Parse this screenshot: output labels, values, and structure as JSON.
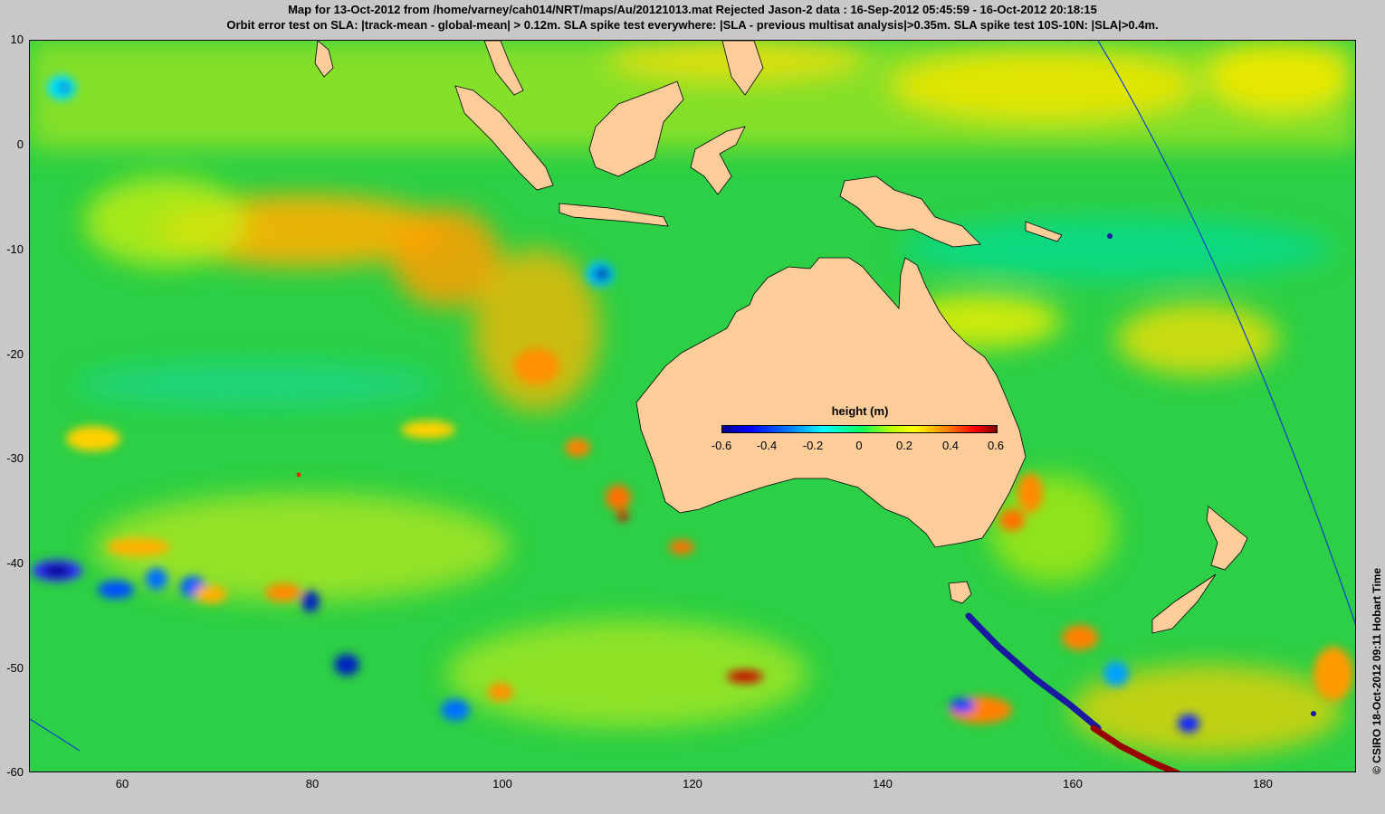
{
  "title_line1": "Map for 13-Oct-2012 from /home/varney/cah014/NRT/maps/Au/20121013.mat  Rejected Jason-2 data : 16-Sep-2012 05:45:59 - 16-Oct-2012 20:18:15",
  "title_line2": "Orbit error test on SLA: |track-mean  - global-mean| > 0.12m.  SLA spike test everywhere: |SLA - previous multisat analysis|>0.35m. SLA spike test 10S-10N: |SLA|>0.4m.",
  "credit": "© CSIRO 18-Oct-2012 09:11 Hobart Time",
  "y_ticks": [
    "10",
    "0",
    "-10",
    "-20",
    "-30",
    "-40",
    "-50",
    "-60"
  ],
  "x_ticks": [
    "60",
    "80",
    "100",
    "120",
    "140",
    "160",
    "180"
  ],
  "colorbar": {
    "title": "height (m)",
    "ticks": [
      "-0.6",
      "-0.4",
      "-0.2",
      "0",
      "0.2",
      "0.4",
      "0.6"
    ]
  },
  "map_extent": {
    "lon": [
      50,
      190
    ],
    "lat": [
      -60,
      10
    ]
  },
  "colors": {
    "land": "#fccc99",
    "background": "#c8c8c8",
    "ocean_base": "#22cc44",
    "track_positive": "#990000",
    "track_negative": "#1a1aa0"
  }
}
